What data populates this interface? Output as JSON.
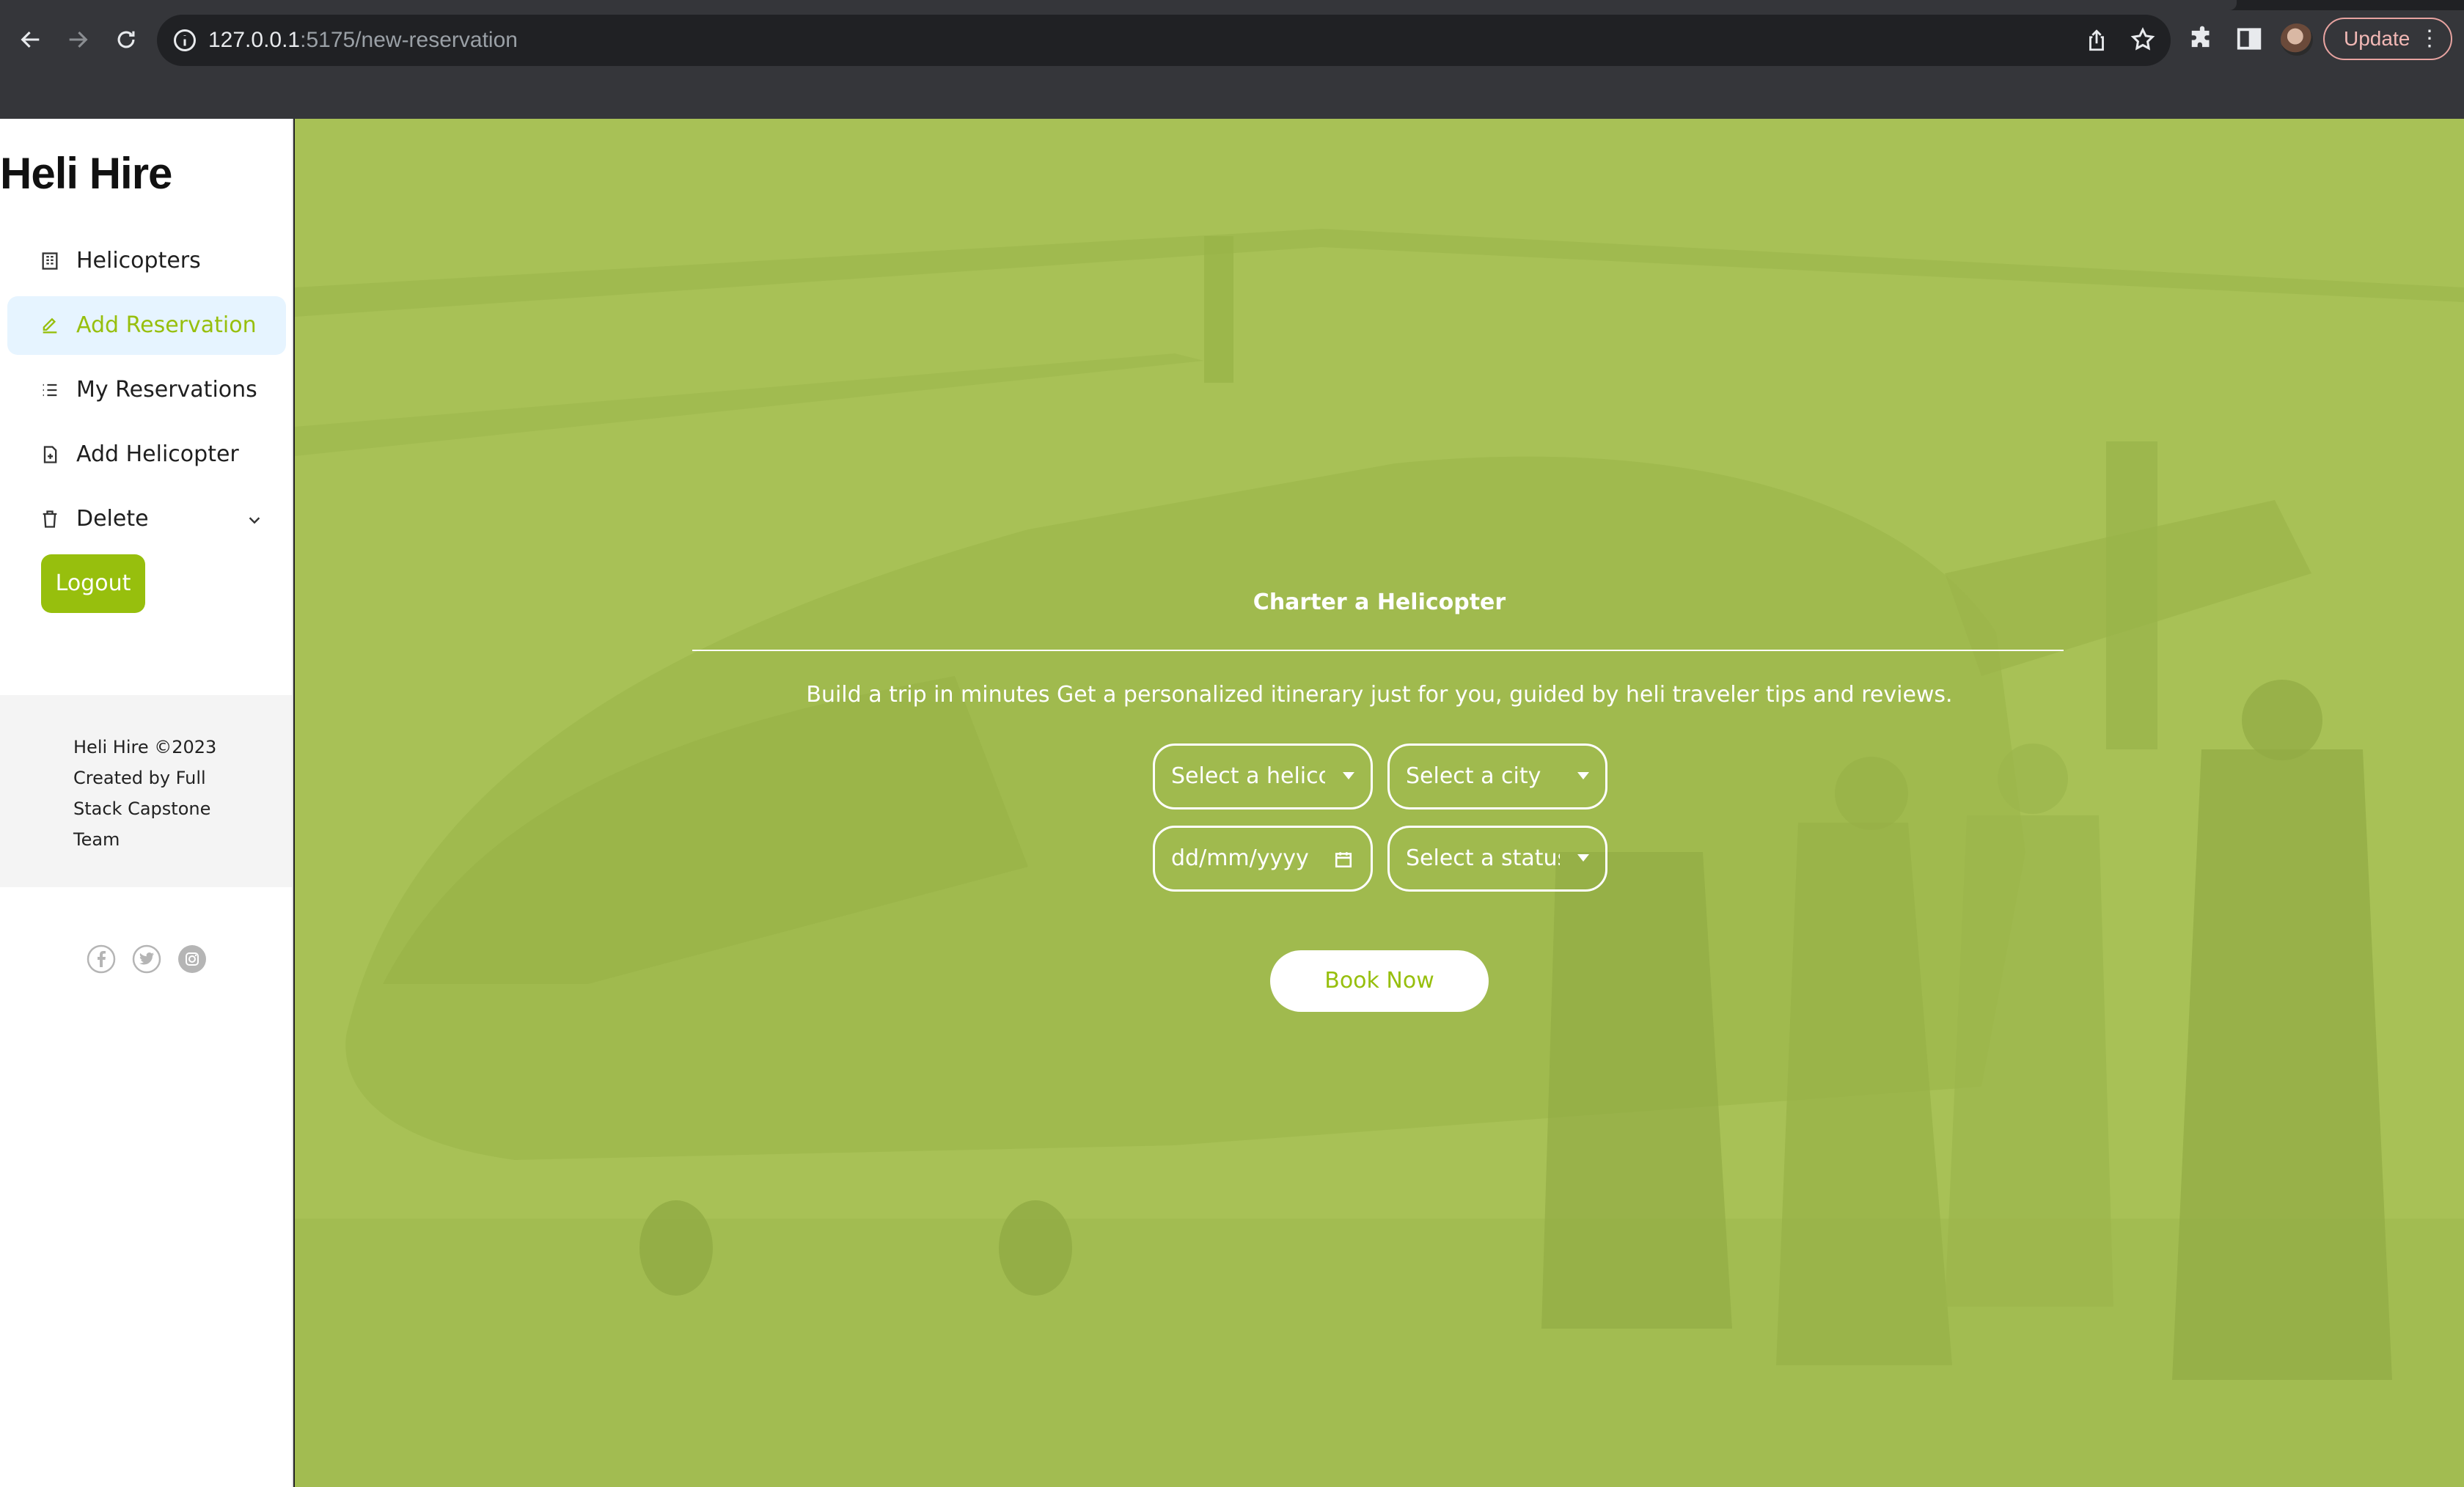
{
  "browser": {
    "url_host": "127.0.0.1",
    "url_path": ":5175/new-reservation",
    "update_label": "Update",
    "menu_dots": "⋮"
  },
  "app": {
    "brand": "Heli Hire",
    "accent_color": "#97bf0d",
    "nav": [
      {
        "label": "Helicopters",
        "icon": "building-icon",
        "active": false
      },
      {
        "label": "Add Reservation",
        "icon": "edit-icon",
        "active": true
      },
      {
        "label": "My Reservations",
        "icon": "list-icon",
        "active": false
      },
      {
        "label": "Add Helicopter",
        "icon": "file-add-icon",
        "active": false
      },
      {
        "label": "Delete",
        "icon": "trash-icon",
        "active": false,
        "expandable": true
      }
    ],
    "logout_label": "Logout",
    "footer": "Heli Hire ©2023 Created by Full Stack Capstone Team",
    "social": [
      "facebook-icon",
      "twitter-icon",
      "instagram-icon"
    ]
  },
  "form": {
    "title": "Charter a Helicopter",
    "tagline": "Build a trip in minutes Get a personalized itinerary just for you, guided by heli traveler tips and reviews.",
    "helicopter_placeholder": "Select a helicopter",
    "city_placeholder": "Select a city",
    "date_placeholder": "dd/mm/yyyy",
    "status_placeholder": "Select a status",
    "submit_label": "Book Now"
  }
}
